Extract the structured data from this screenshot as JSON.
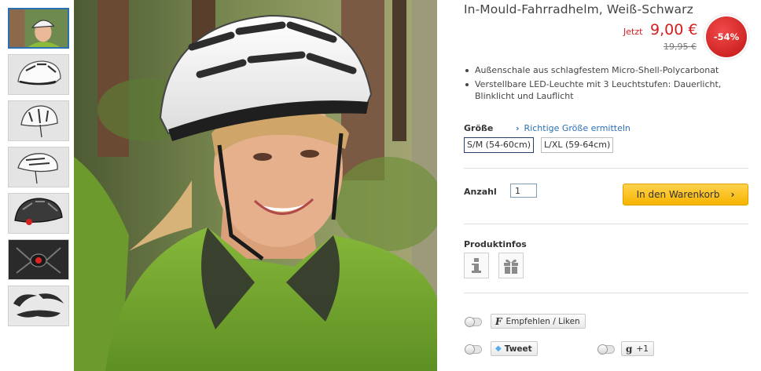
{
  "product": {
    "title": "In-Mould-Fahrradhelm, Weiß-Schwarz",
    "price_label": "Jetzt",
    "price": "9,00 €",
    "old_price": "19,95 €",
    "discount": "-54%",
    "features": [
      "Außenschale aus schlagfestem Micro-Shell-Polycarbonat",
      "Verstellbare LED-Leuchte mit 3 Leuchtstufen: Dauerlicht, Blinklicht und Lauflicht"
    ]
  },
  "size": {
    "label": "Größe",
    "guide_link": "Richtige Größe ermitteln",
    "options": [
      "S/M (54-60cm)",
      "L/XL (59-64cm)"
    ],
    "selected": "S/M (54-60cm)"
  },
  "quantity": {
    "label": "Anzahl",
    "value": "1"
  },
  "cart": {
    "button_label": "In den Warenkorb",
    "arrow": "›"
  },
  "product_info": {
    "label": "Produktinfos",
    "icons": [
      "info-icon",
      "gift-icon"
    ]
  },
  "social": {
    "facebook_label": "Empfehlen / Liken",
    "twitter_label": "Tweet",
    "gplus_label": "+1"
  },
  "gallery": {
    "thumbnails": [
      "woman-wearing-helmet",
      "helmet-side-white",
      "helmet-front-white",
      "helmet-rear-white",
      "helmet-rear-led-dark",
      "led-light-closeup",
      "helmet-pads"
    ],
    "active_index": 0
  },
  "colors": {
    "price_red": "#d41c1c",
    "link_blue": "#2b6fb3",
    "cart_yellow": "#f7b400"
  }
}
